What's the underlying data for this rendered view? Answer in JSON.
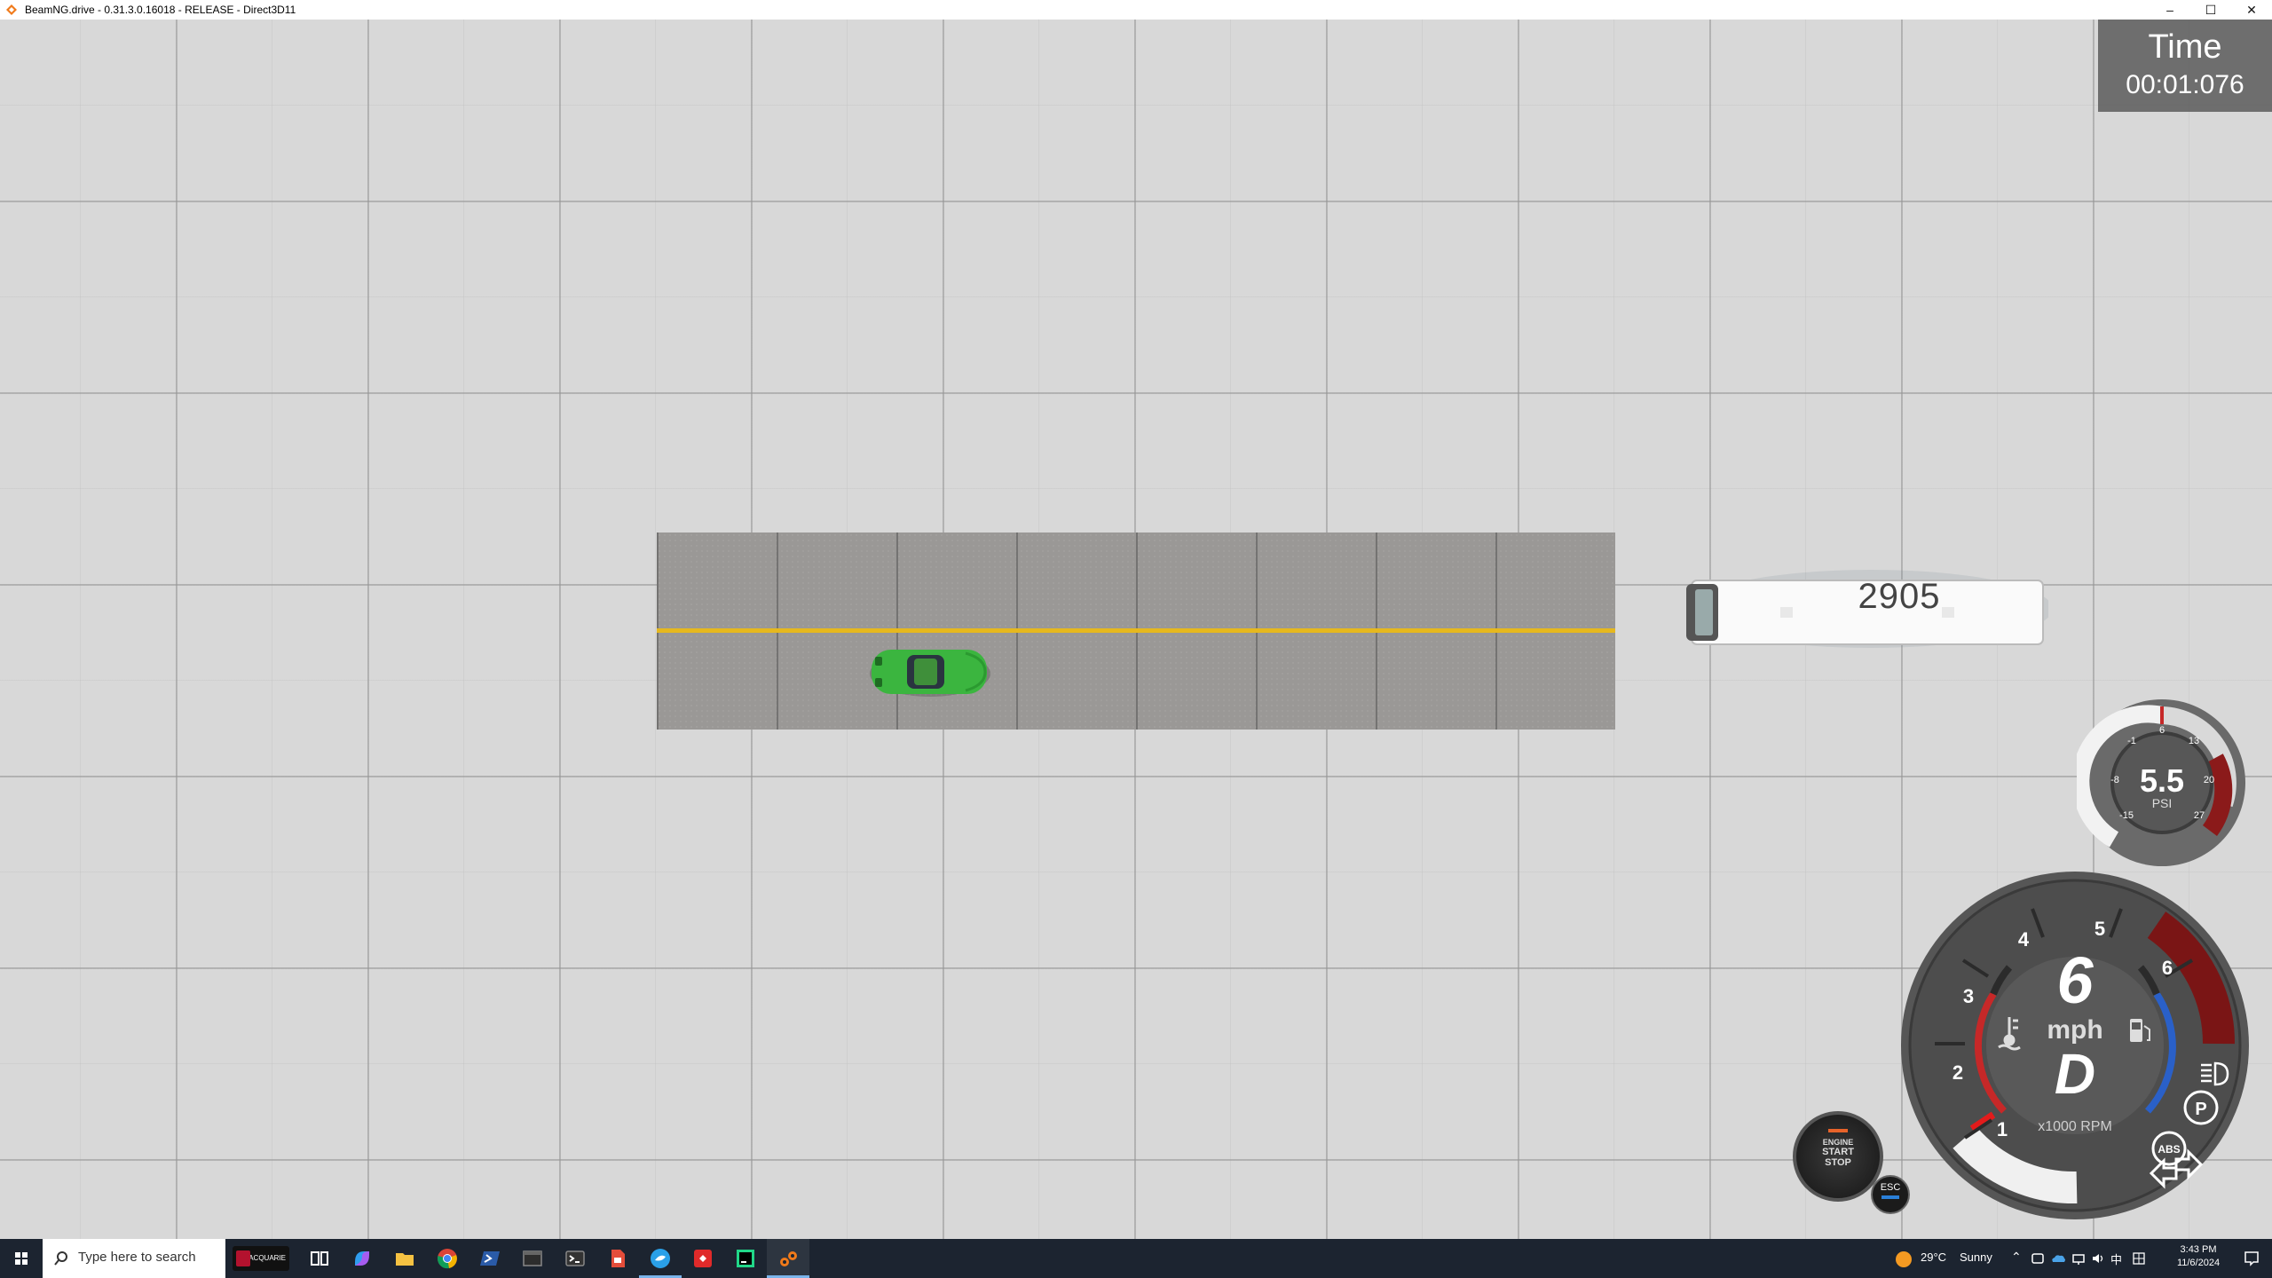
{
  "window": {
    "title": "BeamNG.drive - 0.31.3.0.16018 - RELEASE - Direct3D11",
    "minimize_glyph": "–",
    "maximize_glyph": "☐",
    "close_glyph": "✕"
  },
  "scene": {
    "bus_number": "2905"
  },
  "hud": {
    "time_label": "Time",
    "time_value": "00:01:076",
    "boost": {
      "value": "5.5",
      "unit": "PSI",
      "ticks": [
        "-1",
        "6",
        "13",
        "-8",
        "20",
        "-15",
        "27"
      ]
    },
    "speedo": {
      "speed": "6",
      "unit": "mph",
      "gear": "D",
      "rpm_label": "x1000 RPM",
      "rpm_ticks": [
        "1",
        "2",
        "3",
        "4",
        "5",
        "6"
      ]
    },
    "indicators": {
      "parking": "P",
      "abs": "ABS"
    },
    "engine_button": {
      "line1": "ENGINE",
      "line2": "START",
      "line3": "STOP"
    },
    "esc_label": "ESC"
  },
  "taskbar": {
    "search_placeholder": "Type here to search",
    "pinned_label": "MACQUARIE",
    "weather_temp": "29°C",
    "weather_text": "Sunny",
    "ime": "中",
    "time": "3:43 PM",
    "date": "11/6/2024"
  },
  "colors": {
    "road_line": "#e6b81e",
    "car": "#3bb53f",
    "redline": "#8b1a1a",
    "gauge_blue": "#2a60c8",
    "taskbar": "#1c2430"
  }
}
